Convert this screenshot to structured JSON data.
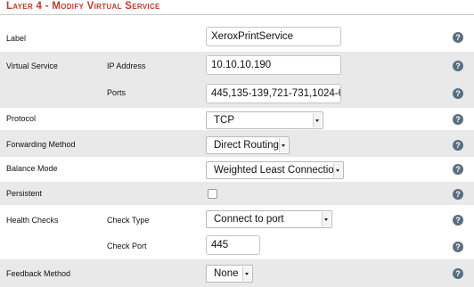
{
  "title": "Layer 4 - Modify Virtual Service",
  "help_glyph": "?",
  "rows": {
    "label": {
      "label": "Label",
      "value": "XeroxPrintService"
    },
    "virtual_service": {
      "label": "Virtual Service",
      "ip_label": "IP Address",
      "ip_value": "10.10.10.190",
      "ports_label": "Ports",
      "ports_value": "445,135-139,721-731,1024-6"
    },
    "protocol": {
      "label": "Protocol",
      "value": "TCP"
    },
    "forwarding": {
      "label": "Forwarding Method",
      "value": "Direct Routing"
    },
    "balance": {
      "label": "Balance Mode",
      "value": "Weighted Least Connection"
    },
    "persistent": {
      "label": "Persistent",
      "checked": false
    },
    "health": {
      "label": "Health Checks",
      "type_label": "Check Type",
      "type_value": "Connect to port",
      "port_label": "Check Port",
      "port_value": "445"
    },
    "feedback": {
      "label": "Feedback Method",
      "value": "None"
    }
  },
  "colors": {
    "title": "#c0392b",
    "shade": "#e9e9e9",
    "help": "#5a6e80"
  }
}
